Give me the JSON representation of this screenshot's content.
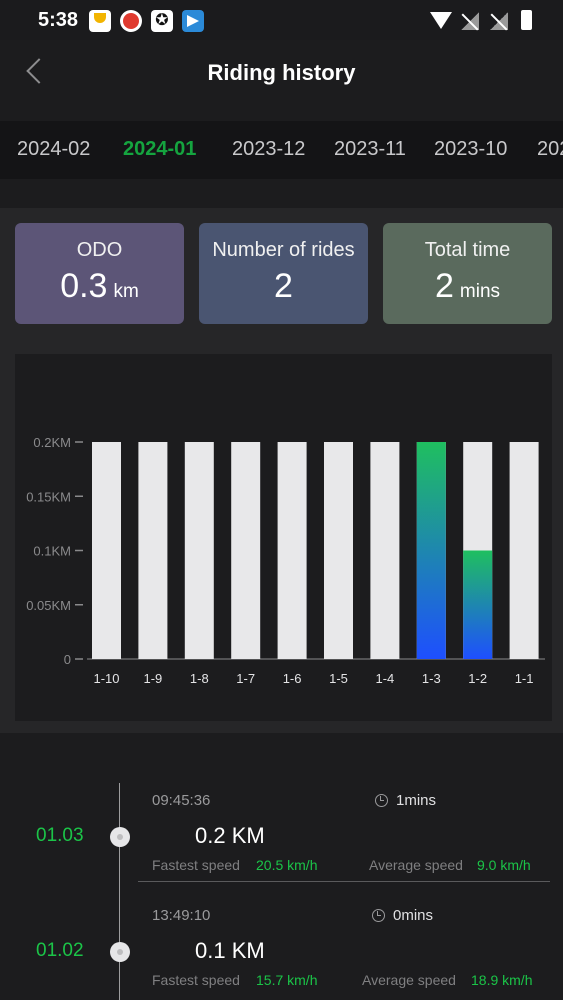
{
  "status_bar": {
    "time": "5:38",
    "icons": [
      "app-icon",
      "app-icon",
      "app-icon",
      "telegram-icon",
      "wifi-icon",
      "no-signal-icon",
      "no-signal-icon",
      "battery-icon"
    ]
  },
  "header": {
    "back_icon": "chevron-left-icon",
    "title": "Riding history"
  },
  "month_tabs": [
    {
      "label": "2024-02",
      "active": false
    },
    {
      "label": "2024-01",
      "active": true
    },
    {
      "label": "2023-12",
      "active": false
    },
    {
      "label": "2023-11",
      "active": false
    },
    {
      "label": "2023-10",
      "active": false
    },
    {
      "label": "202",
      "active": false
    }
  ],
  "stats": {
    "odo": {
      "label": "ODO",
      "value": "0.3",
      "unit": "km"
    },
    "rides": {
      "label": "Number of rides",
      "value": "2"
    },
    "time": {
      "label": "Total time",
      "value": "2",
      "unit": "mins"
    }
  },
  "chart_data": {
    "type": "bar",
    "categories": [
      "1-10",
      "1-9",
      "1-8",
      "1-7",
      "1-6",
      "1-5",
      "1-4",
      "1-3",
      "1-2",
      "1-1"
    ],
    "values": [
      0,
      0,
      0,
      0,
      0,
      0,
      0,
      0.2,
      0.1,
      0
    ],
    "yticks": [
      "0",
      "0.05KM",
      "0.1KM",
      "0.15KM",
      "0.2KM"
    ],
    "ylim": [
      0,
      0.2
    ],
    "background_bar_color": "#e8e8ea",
    "gradient_colors": [
      "#1fbf5f",
      "#1e4fff"
    ]
  },
  "rides": [
    {
      "date": "01.03",
      "start_time": "09:45:36",
      "duration": "1mins",
      "distance": "0.2 KM",
      "fastest_label": "Fastest speed",
      "fastest": "20.5 km/h",
      "average_label": "Average speed",
      "average": "9.0 km/h"
    },
    {
      "date": "01.02",
      "start_time": "13:49:10",
      "duration": "0mins",
      "distance": "0.1 KM",
      "fastest_label": "Fastest speed",
      "fastest": "15.7 km/h",
      "average_label": "Average speed",
      "average": "18.9 km/h"
    }
  ],
  "colors": {
    "accent_green": "#15a43f",
    "odo_card": "#5c5577",
    "rides_card": "#4a5571",
    "time_card": "#5a6a5d"
  }
}
